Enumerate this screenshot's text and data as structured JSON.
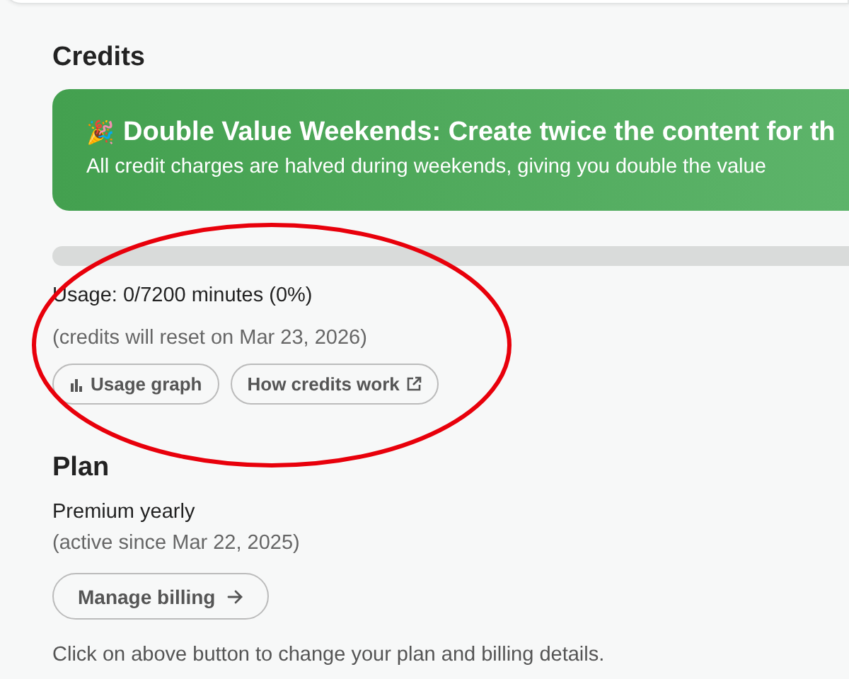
{
  "credits": {
    "heading": "Credits",
    "banner": {
      "emoji": "🎉",
      "title": "Double Value Weekends: Create twice the content for th",
      "text": "All credit charges are halved during weekends, giving you double the value"
    },
    "usage_bar": {
      "level": 0
    },
    "usage": "Usage: 0/7200 minutes (0%)",
    "reset_note": "(credits will reset on Mar 23, 2026)",
    "buttons": [
      {
        "kind": "graph",
        "label": "Usage graph"
      },
      {
        "kind": "external",
        "label": "How credits work"
      }
    ]
  },
  "plan": {
    "heading": "Plan",
    "name": "Premium yearly",
    "since": "(active since Mar 22, 2025)",
    "button": {
      "label": "Manage billing",
      "kind": "arrow"
    },
    "note": "Click on above button to change your plan and billing details."
  },
  "annotation": {
    "kind": "ellipse",
    "color": "#e8000b"
  }
}
